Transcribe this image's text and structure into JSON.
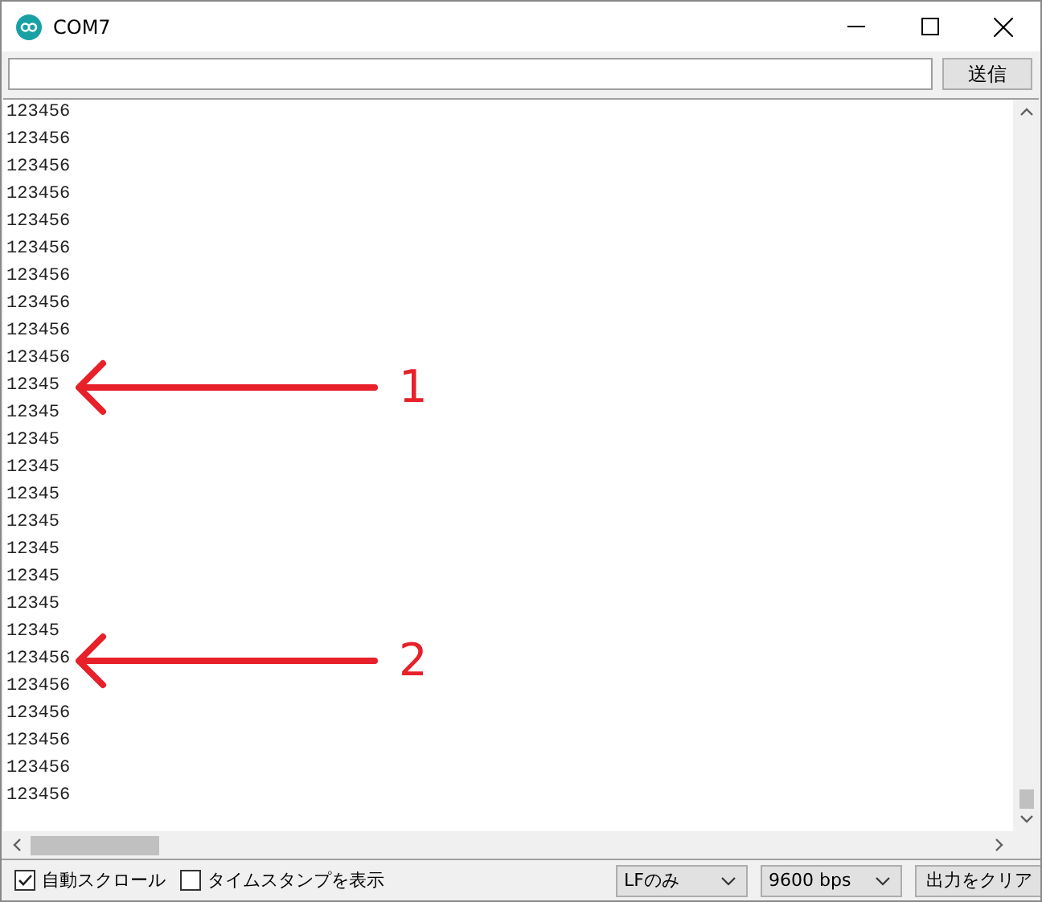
{
  "window": {
    "title": "COM7"
  },
  "send_button": "送信",
  "output_lines": [
    {
      "text": "123456"
    },
    {
      "text": "123456"
    },
    {
      "text": "123456"
    },
    {
      "text": "123456"
    },
    {
      "text": "123456"
    },
    {
      "text": "123456"
    },
    {
      "text": "123456"
    },
    {
      "text": "123456"
    },
    {
      "text": "123456"
    },
    {
      "text": "123456"
    },
    {
      "text": "12345",
      "annotation": "1"
    },
    {
      "text": "12345"
    },
    {
      "text": "12345"
    },
    {
      "text": "12345"
    },
    {
      "text": "12345"
    },
    {
      "text": "12345"
    },
    {
      "text": "12345"
    },
    {
      "text": "12345"
    },
    {
      "text": "12345"
    },
    {
      "text": "12345"
    },
    {
      "text": "123456",
      "annotation": "2"
    },
    {
      "text": "123456"
    },
    {
      "text": "123456"
    },
    {
      "text": "123456"
    },
    {
      "text": "123456"
    },
    {
      "text": "123456"
    }
  ],
  "checkboxes": [
    {
      "label": "自動スクロール",
      "checked": true
    },
    {
      "label": "タイムスタンプを表示",
      "checked": false
    }
  ],
  "dropdowns": [
    "LFのみ",
    "9600 bps"
  ],
  "clear_button": "出力をクリア"
}
